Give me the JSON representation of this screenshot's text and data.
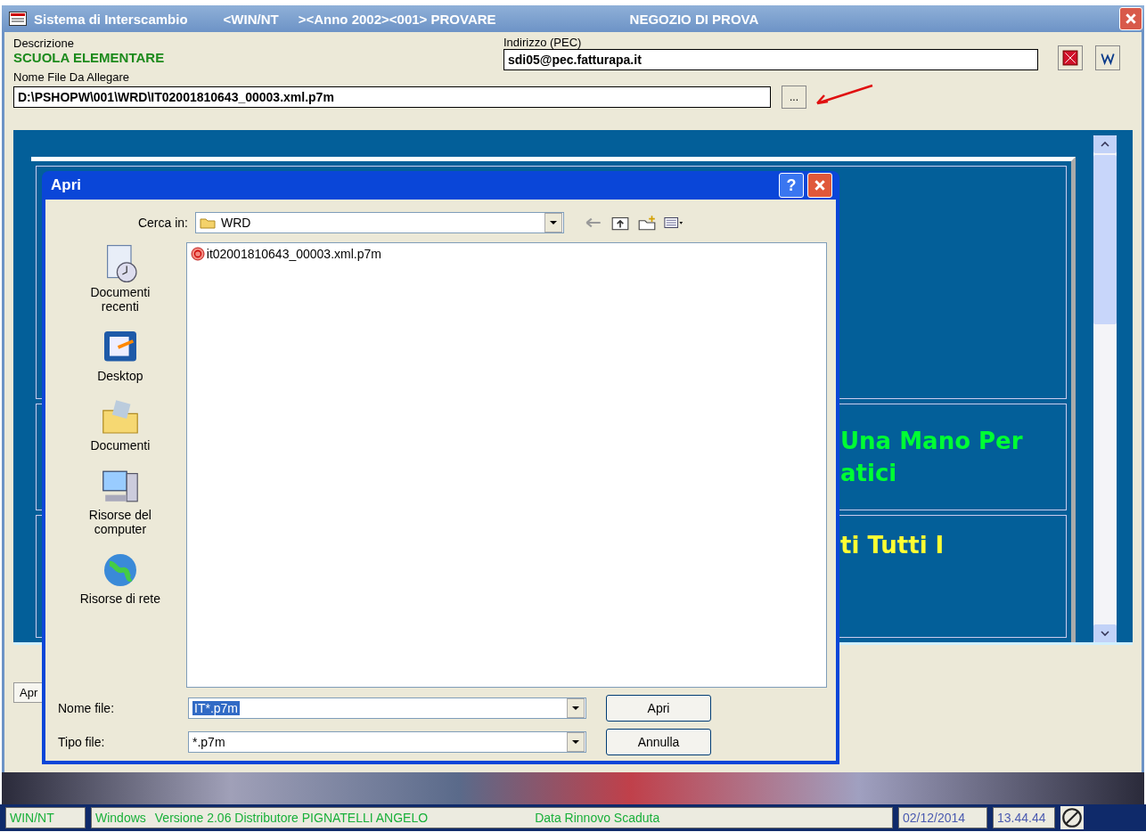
{
  "window": {
    "title_parts": [
      "Sistema di Interscambio",
      "<WIN/NT",
      "><Anno 2002><001> PROVARE",
      "NEGOZIO DI PROVA"
    ]
  },
  "form": {
    "description_label": "Descrizione",
    "description": "SCUOLA ELEMENTARE",
    "pec_label": "Indirizzo (PEC)",
    "pec": "sdi05@pec.fatturapa.it",
    "file_label": "Nome File Da Allegare",
    "file": "D:\\PSHOPW\\001\\WRD\\IT02001810643_00003.xml.p7m",
    "browse": "..."
  },
  "panel": {
    "lines": [
      {
        "text": "Una Mano Per",
        "color": "#00ff33"
      },
      {
        "text": "atici",
        "color": "#00ff33"
      },
      {
        "text": "ti Tutti I",
        "color": "#ffff33"
      }
    ]
  },
  "bottom_tab": "Apr",
  "dialog": {
    "title": "Apri",
    "help": "?",
    "look_in_label": "Cerca in:",
    "look_in": "WRD",
    "places": [
      {
        "label": "Documenti recenti",
        "kind": "recent"
      },
      {
        "label": "Desktop",
        "kind": "desktop"
      },
      {
        "label": "Documenti",
        "kind": "documents"
      },
      {
        "label": "Risorse del computer",
        "kind": "computer"
      },
      {
        "label": "Risorse di rete",
        "kind": "network"
      }
    ],
    "files": [
      "it02001810643_00003.xml.p7m"
    ],
    "filename_label": "Nome file:",
    "filename": "IT*.p7m",
    "filetype_label": "Tipo file:",
    "filetype": "*.p7m",
    "open": "Apri",
    "cancel": "Annulla"
  },
  "status_bar": [
    "WIN/NT",
    "Windows",
    "Versione 2.06 Distributore PIGNATELLI ANGELO",
    "Data Rinnovo Scaduta",
    "02/12/2014",
    "13.44.44"
  ]
}
